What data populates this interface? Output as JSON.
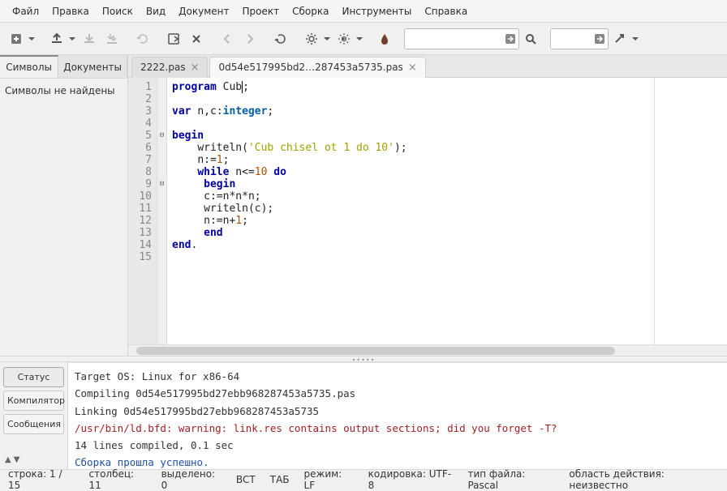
{
  "menu": [
    "Файл",
    "Правка",
    "Поиск",
    "Вид",
    "Документ",
    "Проект",
    "Сборка",
    "Инструменты",
    "Справка"
  ],
  "sidebar": {
    "tabs": [
      "Символы",
      "Документы"
    ],
    "active": 0,
    "message": "Символы не найдены"
  },
  "tabs": [
    {
      "label": "2222.pas",
      "active": false
    },
    {
      "label": "0d54e517995bd2…287453a5735.pas",
      "active": true
    }
  ],
  "code": {
    "lines": [
      {
        "n": 1,
        "fold": "",
        "seg": [
          [
            "kw",
            "program"
          ],
          [
            "op",
            " "
          ],
          [
            "id",
            "Cub"
          ],
          [
            "caret",
            ""
          ],
          [
            "op",
            ";"
          ]
        ]
      },
      {
        "n": 2,
        "fold": "",
        "seg": []
      },
      {
        "n": 3,
        "fold": "",
        "seg": [
          [
            "kw",
            "var"
          ],
          [
            "op",
            " "
          ],
          [
            "id",
            "n"
          ],
          [
            "op",
            ","
          ],
          [
            "id",
            "c"
          ],
          [
            "op",
            ":"
          ],
          [
            "ty",
            "integer"
          ],
          [
            "op",
            ";"
          ]
        ]
      },
      {
        "n": 4,
        "fold": "",
        "seg": []
      },
      {
        "n": 5,
        "fold": "⊟",
        "seg": [
          [
            "kw",
            "begin"
          ]
        ]
      },
      {
        "n": 6,
        "fold": "",
        "seg": [
          [
            "op",
            "    "
          ],
          [
            "id",
            "writeln"
          ],
          [
            "op",
            "("
          ],
          [
            "st",
            "'Cub chisel ot 1 do 10'"
          ],
          [
            "op",
            ");"
          ]
        ]
      },
      {
        "n": 7,
        "fold": "",
        "seg": [
          [
            "op",
            "    "
          ],
          [
            "id",
            "n"
          ],
          [
            "op",
            ":="
          ],
          [
            "nm",
            "1"
          ],
          [
            "op",
            ";"
          ]
        ]
      },
      {
        "n": 8,
        "fold": "",
        "seg": [
          [
            "op",
            "    "
          ],
          [
            "kw",
            "while"
          ],
          [
            "op",
            " "
          ],
          [
            "id",
            "n"
          ],
          [
            "op",
            "<="
          ],
          [
            "nm",
            "10"
          ],
          [
            "op",
            " "
          ],
          [
            "kw",
            "do"
          ]
        ]
      },
      {
        "n": 9,
        "fold": "⊟",
        "seg": [
          [
            "op",
            "     "
          ],
          [
            "kw",
            "begin"
          ]
        ]
      },
      {
        "n": 10,
        "fold": "",
        "seg": [
          [
            "op",
            "     "
          ],
          [
            "id",
            "c"
          ],
          [
            "op",
            ":="
          ],
          [
            "id",
            "n"
          ],
          [
            "op",
            "*"
          ],
          [
            "id",
            "n"
          ],
          [
            "op",
            "*"
          ],
          [
            "id",
            "n"
          ],
          [
            "op",
            ";"
          ]
        ]
      },
      {
        "n": 11,
        "fold": "",
        "seg": [
          [
            "op",
            "     "
          ],
          [
            "id",
            "writeln"
          ],
          [
            "op",
            "("
          ],
          [
            "id",
            "c"
          ],
          [
            "op",
            ");"
          ]
        ]
      },
      {
        "n": 12,
        "fold": "",
        "seg": [
          [
            "op",
            "     "
          ],
          [
            "id",
            "n"
          ],
          [
            "op",
            ":="
          ],
          [
            "id",
            "n"
          ],
          [
            "op",
            "+"
          ],
          [
            "nm",
            "1"
          ],
          [
            "op",
            ";"
          ]
        ]
      },
      {
        "n": 13,
        "fold": "",
        "seg": [
          [
            "op",
            "     "
          ],
          [
            "kw",
            "end"
          ]
        ]
      },
      {
        "n": 14,
        "fold": "",
        "seg": [
          [
            "kw",
            "end"
          ],
          [
            "op",
            "."
          ]
        ]
      },
      {
        "n": 15,
        "fold": "",
        "seg": []
      }
    ]
  },
  "bottom_tabs": [
    "Статус",
    "Компилятор",
    "Сообщения"
  ],
  "console": [
    {
      "cls": "",
      "t": "Target OS: Linux for x86-64"
    },
    {
      "cls": "",
      "t": "Compiling 0d54e517995bd27ebb968287453a5735.pas"
    },
    {
      "cls": "",
      "t": "Linking 0d54e517995bd27ebb968287453a5735"
    },
    {
      "cls": "msg-warn",
      "t": "/usr/bin/ld.bfd: warning: link.res contains output sections; did you forget -T?"
    },
    {
      "cls": "",
      "t": "14 lines compiled, 0.1 sec"
    },
    {
      "cls": "msg-ok",
      "t": "Сборка прошла успешно."
    }
  ],
  "status": {
    "line": "строка: 1 / 15",
    "col": "столбец: 11",
    "sel": "выделено: 0",
    "ins": "ВСТ",
    "tab": "ТАБ",
    "eol": "режим: LF",
    "enc": "кодировка: UTF-8",
    "ft": "тип файла: Pascal",
    "scope": "область действия: неизвестно"
  }
}
